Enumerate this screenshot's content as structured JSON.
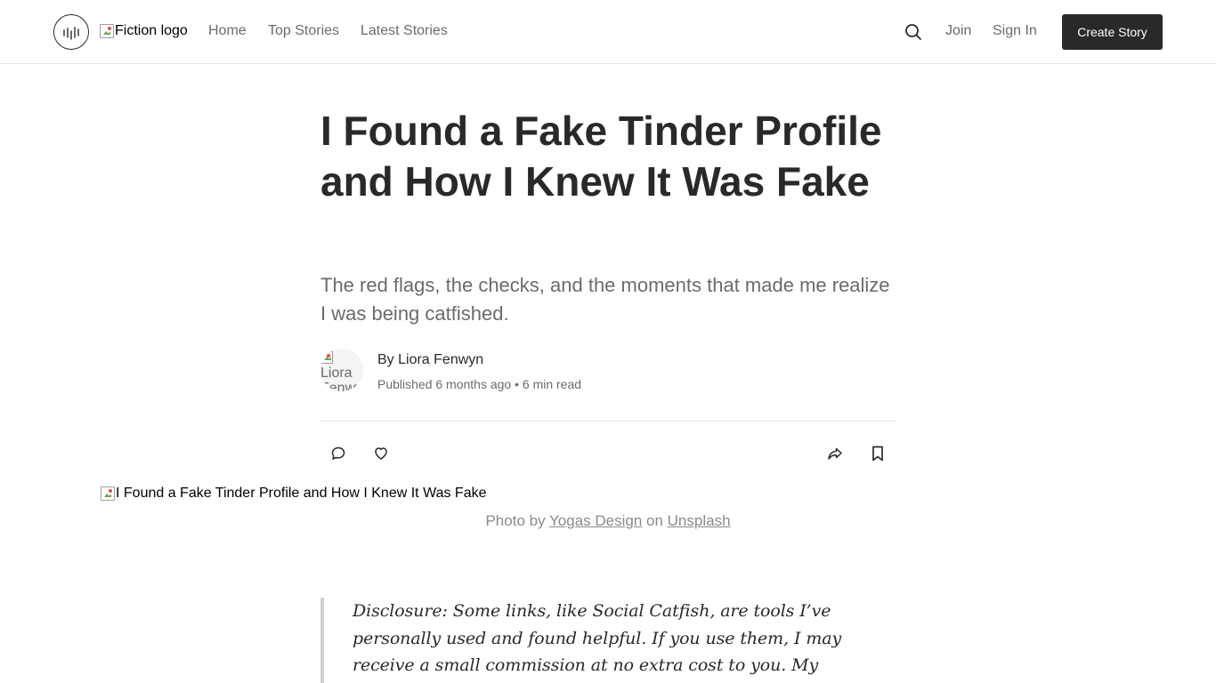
{
  "header": {
    "logo_alt": "Fiction logo",
    "nav": [
      "Home",
      "Top Stories",
      "Latest Stories"
    ],
    "join_label": "Join",
    "signin_label": "Sign In",
    "create_label": "Create Story"
  },
  "article": {
    "title": "I Found a Fake Tinder Profile and How I Knew It Was Fake",
    "subtitle": "The red flags, the checks, and the moments that made me realize I was being catfished.",
    "avatar_alt": "Liora Fenwyn",
    "author": "By Liora Fenwyn",
    "meta": "Published 6 months ago • 6 min read",
    "hero_alt": "I Found a Fake Tinder Profile and How I Knew It Was Fake",
    "caption": {
      "prefix": "Photo by ",
      "photographer": "Yogas Design",
      "middle": " on ",
      "source": "Unsplash"
    },
    "disclosure": "Disclosure: Some links, like Social Catfish, are tools I’ve personally used and found helpful. If you use them, I may receive a small commission at no extra cost to you. My recommendations are based"
  },
  "icons": {
    "logo": "audio-bars-logo-icon",
    "search": "search-icon",
    "comment": "comment-icon",
    "like": "heart-icon",
    "share": "share-icon",
    "bookmark": "bookmark-icon"
  }
}
